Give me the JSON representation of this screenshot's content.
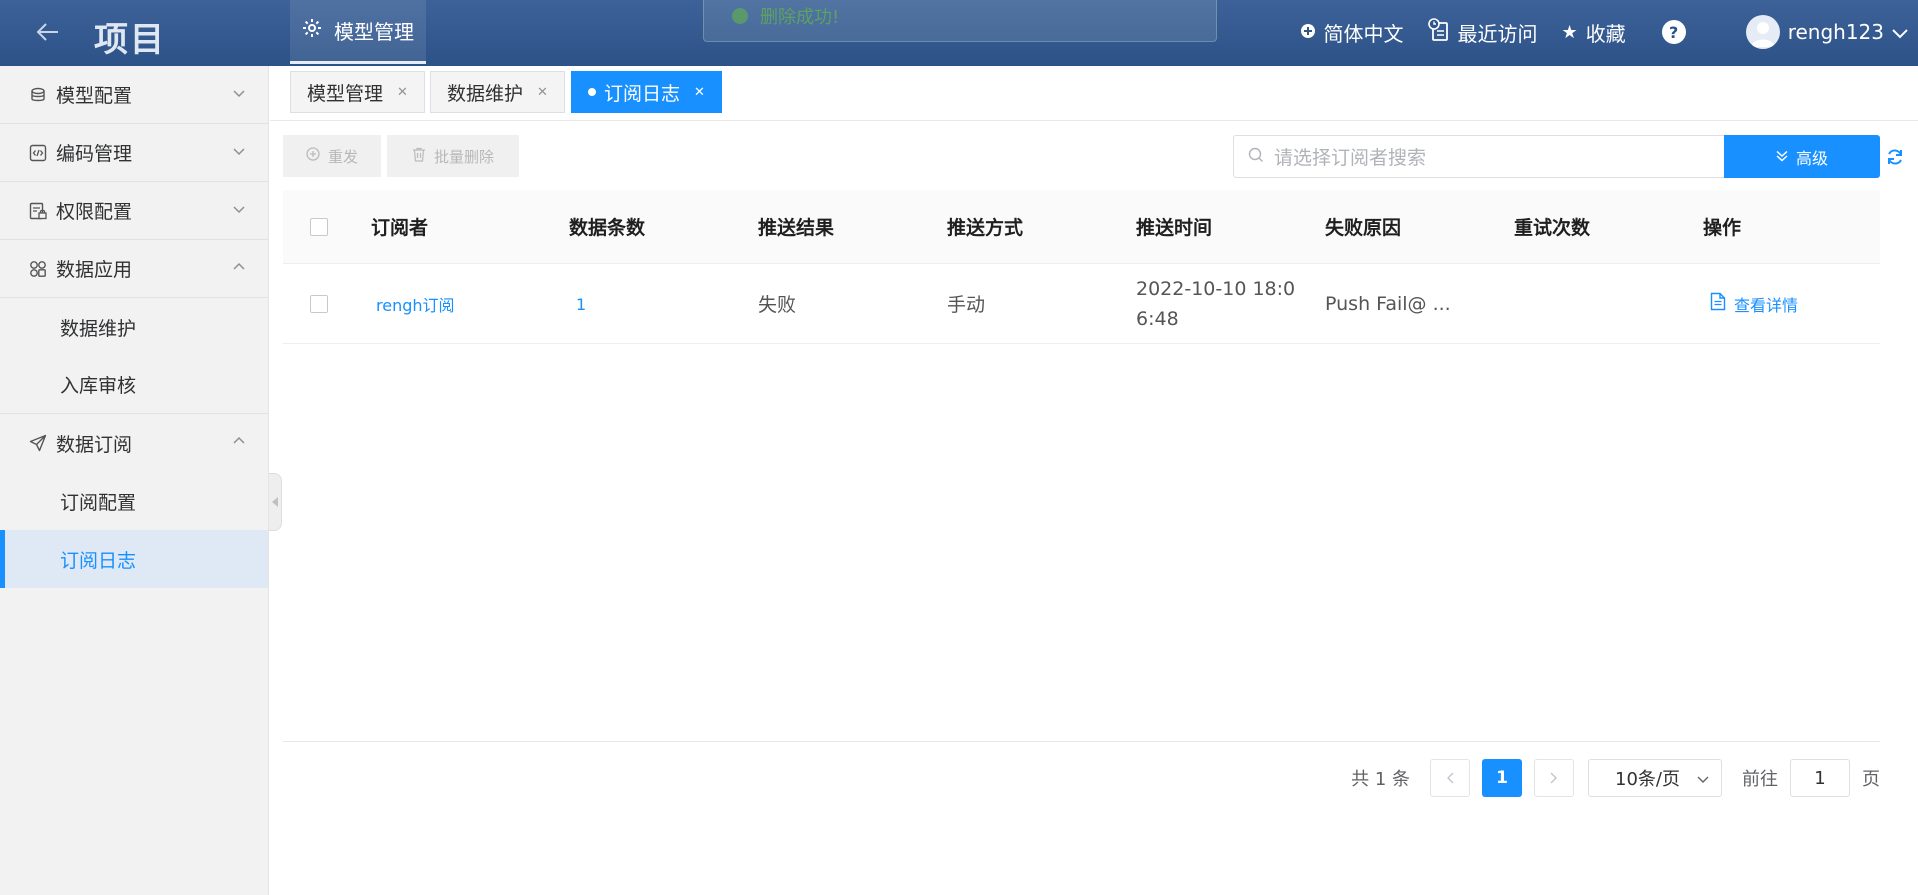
{
  "header": {
    "brand": "项目",
    "nav_active": "模型管理",
    "toast": "删除成功!",
    "language": "简体中文",
    "recent": "最近访问",
    "favorites": "收藏",
    "help": "?",
    "username": "rengh123"
  },
  "sidebar": {
    "items": [
      {
        "label": "模型配置",
        "icon": "database-icon",
        "expanded": false
      },
      {
        "label": "编码管理",
        "icon": "code-icon",
        "expanded": false
      },
      {
        "label": "权限配置",
        "icon": "permission-icon",
        "expanded": false
      },
      {
        "label": "数据应用",
        "icon": "apps-icon",
        "expanded": true,
        "children": [
          "数据维护",
          "入库审核"
        ]
      },
      {
        "label": "数据订阅",
        "icon": "send-icon",
        "expanded": true,
        "children": [
          "订阅配置",
          "订阅日志"
        ]
      }
    ],
    "active": "订阅日志"
  },
  "tabs": [
    {
      "label": "模型管理",
      "active": false
    },
    {
      "label": "数据维护",
      "active": false
    },
    {
      "label": "订阅日志",
      "active": true
    }
  ],
  "toolbar": {
    "resend": "重发",
    "batch_delete": "批量删除",
    "search_placeholder": "请选择订阅者搜索",
    "advanced": "高级"
  },
  "table": {
    "columns": [
      "订阅者",
      "数据条数",
      "推送结果",
      "推送方式",
      "推送时间",
      "失败原因",
      "重试次数",
      "操作"
    ],
    "rows": [
      {
        "subscriber": "rengh订阅",
        "count": "1",
        "result": "失败",
        "method": "手动",
        "time_line1": "2022-10-10 18:0",
        "time_line2": "6:48",
        "reason": "Push Fail@ ...",
        "retries": "",
        "action": "查看详情"
      }
    ]
  },
  "pagination": {
    "total": "共 1 条",
    "current_page": "1",
    "page_size": "10条/页",
    "goto_label": "前往",
    "goto_value": "1",
    "page_suffix": "页"
  },
  "colors": {
    "header_bg": "#2f558b",
    "primary": "#1890ff",
    "sidebar_bg": "#f2f2f2",
    "active_item_bg": "#dfe9f5"
  }
}
